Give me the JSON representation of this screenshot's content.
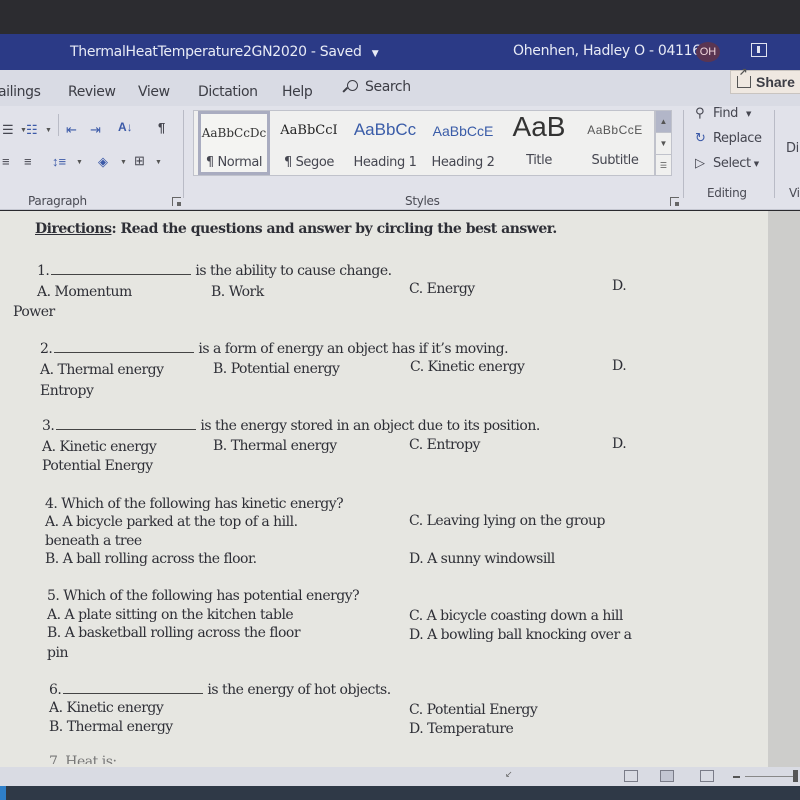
{
  "titlebar": {
    "document_title": "ThermalHeatTemperature2GN2020",
    "save_status": "- Saved",
    "user": "Ohenhen, Hadley O - 0411633",
    "avatar_initials": "OH"
  },
  "tabs": {
    "items": [
      "ailings",
      "Review",
      "View",
      "Dictation",
      "Help"
    ],
    "search_label": "Search",
    "share_label": "Share"
  },
  "ribbon": {
    "paragraph_label": "Paragraph",
    "styles_label": "Styles",
    "editing_label": "Editing",
    "view_partial_label": "Vi",
    "dictate_partial_label": "Di",
    "styles": [
      {
        "preview": "AaBbCcDc",
        "name": "¶ Normal",
        "selected": true
      },
      {
        "preview": "AaBbCcI",
        "name": "¶ Segoe"
      },
      {
        "preview": "AaBbCc",
        "name": "Heading 1"
      },
      {
        "preview": "AaBbCcE",
        "name": "Heading 2"
      },
      {
        "preview": "AaB",
        "name": "Title"
      },
      {
        "preview": "AaBbCcE",
        "name": "Subtitle"
      }
    ],
    "editing": {
      "find": "Find",
      "replace": "Replace",
      "select": "Select"
    }
  },
  "document": {
    "directions_label": "Directions",
    "directions_text": ": Read the questions and answer by circling the best answer.",
    "q1": {
      "number": "1.",
      "stem": "is the ability to cause change.",
      "a": "A. Momentum",
      "b": "B. Work",
      "c": "C. Energy",
      "d": "D.",
      "d_wrap": "Power"
    },
    "q2": {
      "number": "2.",
      "stem": "is a form of energy an object has if it’s moving.",
      "a": "A. Thermal energy",
      "b": "B. Potential energy",
      "c": "C. Kinetic energy",
      "d": "D.",
      "d_wrap": "Entropy"
    },
    "q3": {
      "number": "3.",
      "stem": "is the energy stored in an object due to its position.",
      "a": "A. Kinetic energy",
      "b": "B. Thermal energy",
      "c": "C. Entropy",
      "d": "D.",
      "d_wrap": "Potential Energy"
    },
    "q4": {
      "stem": "4. Which of the following has kinetic energy?",
      "a": "A. A bicycle parked at the top of a hill.",
      "c": "C. Leaving lying on the group",
      "c_wrap": "beneath a tree",
      "b": "B. A ball rolling across the floor.",
      "d": "D. A sunny windowsill"
    },
    "q5": {
      "stem": "5. Which of the following has potential energy?",
      "a": "A. A plate sitting on the kitchen table",
      "c": "C. A bicycle coasting down a hill",
      "b": "B. A basketball rolling across the floor",
      "d": "D. A bowling ball knocking over a",
      "d_wrap": "pin"
    },
    "q6": {
      "number": "6.",
      "stem": "is the energy of hot objects.",
      "a": "A. Kinetic energy",
      "c": "C. Potential Energy",
      "b": "B. Thermal energy",
      "d": "D. Temperature"
    },
    "q7_partial": "7. Heat is:"
  }
}
